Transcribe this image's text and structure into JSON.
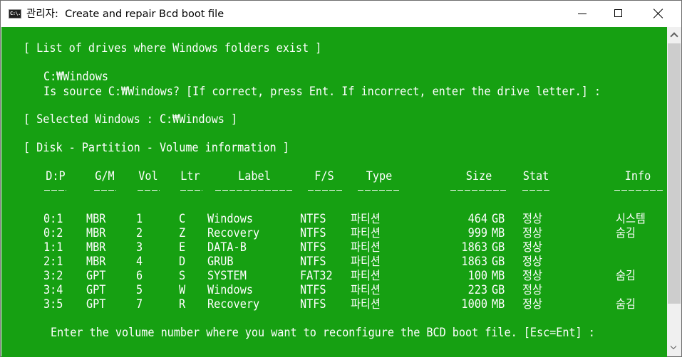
{
  "window": {
    "title": "관리자:  Create and repair Bcd boot file",
    "icon": "cmd-icon",
    "icon_text": "C:\\.",
    "controls": [
      "minimize",
      "maximize",
      "close"
    ]
  },
  "colors": {
    "console_bg": "#16a012",
    "console_fg": "#ffffff",
    "titlebar_bg": "#ffffff",
    "scrollbar_thumb": "#cdcdcd"
  },
  "console": {
    "drives_header": "[ List of drives where Windows folders exist ]",
    "found_path": "C:₩Windows",
    "source_prompt": "Is source C:₩Windows? [If correct, press Ent. If incorrect, enter the drive letter.] :",
    "selected_windows": "[ Selected Windows : C:₩Windows ]",
    "disk_info_header": "[ Disk - Partition - Volume information ]",
    "table": {
      "columns": [
        "D:P",
        "G/M",
        "Vol",
        "Ltr",
        "Label",
        "F/S",
        "Type",
        "Size",
        "Stat",
        "Info"
      ],
      "rows": [
        {
          "dp": "0:1",
          "gm": "MBR",
          "vol": "1",
          "ltr": "C",
          "label": "Windows",
          "fs": "NTFS",
          "type": "파티션",
          "size": "464",
          "unit": "GB",
          "stat": "정상",
          "info": "시스템"
        },
        {
          "dp": "0:2",
          "gm": "MBR",
          "vol": "2",
          "ltr": "Z",
          "label": "Recovery",
          "fs": "NTFS",
          "type": "파티션",
          "size": "999",
          "unit": "MB",
          "stat": "정상",
          "info": "숨김"
        },
        {
          "dp": "1:1",
          "gm": "MBR",
          "vol": "3",
          "ltr": "E",
          "label": "DATA-B",
          "fs": "NTFS",
          "type": "파티션",
          "size": "1863",
          "unit": "GB",
          "stat": "정상",
          "info": ""
        },
        {
          "dp": "2:1",
          "gm": "MBR",
          "vol": "4",
          "ltr": "D",
          "label": "GRUB",
          "fs": "NTFS",
          "type": "파티션",
          "size": "1863",
          "unit": "GB",
          "stat": "정상",
          "info": ""
        },
        {
          "dp": "3:2",
          "gm": "GPT",
          "vol": "6",
          "ltr": "S",
          "label": "SYSTEM",
          "fs": "FAT32",
          "type": "파티션",
          "size": "100",
          "unit": "MB",
          "stat": "정상",
          "info": "숨김"
        },
        {
          "dp": "3:4",
          "gm": "GPT",
          "vol": "5",
          "ltr": "W",
          "label": "Windows",
          "fs": "NTFS",
          "type": "파티션",
          "size": "223",
          "unit": "GB",
          "stat": "정상",
          "info": ""
        },
        {
          "dp": "3:5",
          "gm": "GPT",
          "vol": "7",
          "ltr": "R",
          "label": "Recovery",
          "fs": "NTFS",
          "type": "파티션",
          "size": "1000",
          "unit": "MB",
          "stat": "정상",
          "info": "숨김"
        }
      ]
    },
    "volume_prompt": "Enter the volume number where you want to reconfigure the BCD boot file. [Esc=Ent] :"
  }
}
